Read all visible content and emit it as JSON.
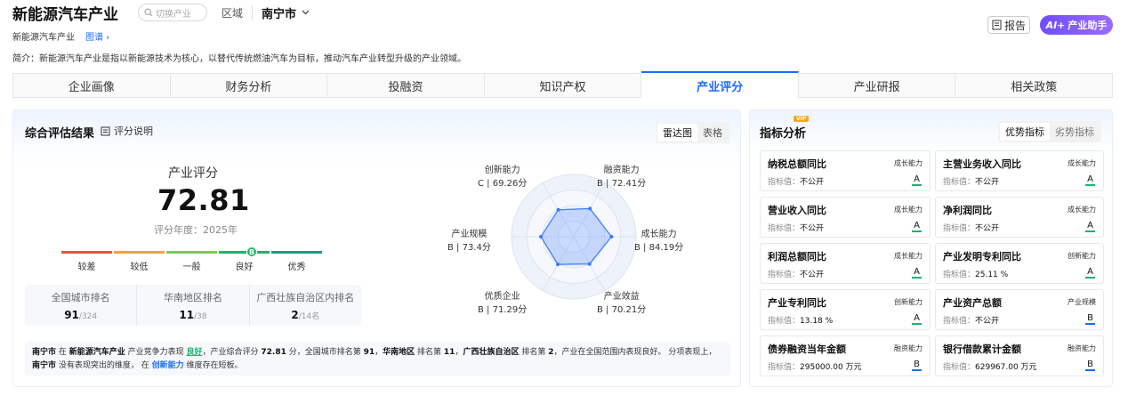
{
  "header": {
    "title": "新能源汽车产业",
    "search_placeholder": "切换产业",
    "region_label": "区域",
    "city": "南宁市"
  },
  "crumbs": {
    "current": "新能源汽车产业",
    "link": "图谱"
  },
  "intro": "简介：新能源汽车产业是指以新能源技术为核心，以替代传统燃油汽车为目标，推动汽车产业转型升级的产业领域。",
  "actions": {
    "report": "报告",
    "ai_badge": "AI+",
    "ai_label": "产业助手"
  },
  "tabs": [
    {
      "label": "企业画像"
    },
    {
      "label": "财务分析"
    },
    {
      "label": "投融资"
    },
    {
      "label": "知识产权"
    },
    {
      "label": "产业评分"
    },
    {
      "label": "产业研报"
    },
    {
      "label": "相关政策"
    }
  ],
  "left_panel": {
    "title": "综合评估结果",
    "explain": "评分说明",
    "view_options": [
      "雷达图",
      "表格"
    ],
    "score_label": "产业评分",
    "score": "72.81",
    "year": "评分年度：2025年",
    "scale": {
      "labels": [
        "较差",
        "较低",
        "一般",
        "良好",
        "优秀"
      ],
      "colors": [
        "#e8562a",
        "#f4a52b",
        "#85c94f",
        "#1db46a",
        "#13a08c"
      ],
      "current_grade": "B",
      "current_level": 4
    },
    "ranks": [
      {
        "label": "全国城市排名",
        "value": "91",
        "total": "/324"
      },
      {
        "label": "华南地区排名",
        "value": "11",
        "total": "/38"
      },
      {
        "label": "广西壮族自治区内排名",
        "value": "2",
        "total": "/14名"
      }
    ],
    "radar": [
      {
        "name": "创新能力",
        "grade": "C | 69.26分"
      },
      {
        "name": "融资能力",
        "grade": "B | 72.41分"
      },
      {
        "name": "成长能力",
        "grade": "B | 84.19分"
      },
      {
        "name": "产业效益",
        "grade": "B | 70.21分"
      },
      {
        "name": "优质企业",
        "grade": "B | 71.29分"
      },
      {
        "name": "产业规模",
        "grade": "B | 73.4分"
      }
    ],
    "radar_scores": [
      69.26,
      72.41,
      84.19,
      70.21,
      71.29,
      73.4
    ],
    "summary": {
      "s1": "南宁市",
      "s2": " 在 ",
      "s3": "新能源汽车产业",
      "s4": " 产业竞争力表现 ",
      "s5": "良好",
      "s6": "，产业综合评分 ",
      "s7": "72.81",
      "s8": " 分，全国城市排名第 ",
      "s9": "91",
      "s10": "，",
      "s11": "华南地区",
      "s12": " 排名第 ",
      "s13": "11",
      "s14": "，",
      "s15": "广西壮族自治区",
      "s16": " 排名第 ",
      "s17": "2",
      "s18": "，产业在全国范围内表现良好。 分项表现上，",
      "s19": "南宁市",
      "s20": " 没有表现突出的维度， 在 ",
      "s21": "创新能力",
      "s22": " 维度存在短板。"
    }
  },
  "right_panel": {
    "title": "指标分析",
    "vip": "VIP",
    "toggle": [
      "优势指标",
      "劣势指标"
    ],
    "value_prefix": "指标值：",
    "cards": [
      {
        "name": "纳税总额同比",
        "tag": "成长能力",
        "value": "不公开",
        "grade": "A"
      },
      {
        "name": "主营业务收入同比",
        "tag": "成长能力",
        "value": "不公开",
        "grade": "A"
      },
      {
        "name": "营业收入同比",
        "tag": "成长能力",
        "value": "不公开",
        "grade": "A"
      },
      {
        "name": "净利润同比",
        "tag": "成长能力",
        "value": "不公开",
        "grade": "A"
      },
      {
        "name": "利润总额同比",
        "tag": "成长能力",
        "value": "不公开",
        "grade": "A"
      },
      {
        "name": "产业发明专利同比",
        "tag": "创新能力",
        "value": "25.11 %",
        "grade": "A"
      },
      {
        "name": "产业专利同比",
        "tag": "创新能力",
        "value": "13.18 %",
        "grade": "A"
      },
      {
        "name": "产业资产总额",
        "tag": "产业规模",
        "value": "不公开",
        "grade": "B"
      },
      {
        "name": "债券融资当年金额",
        "tag": "融资能力",
        "value": "295000.00 万元",
        "grade": "B"
      },
      {
        "name": "银行借款累计金额",
        "tag": "融资能力",
        "value": "629967.00 万元",
        "grade": "B"
      }
    ]
  }
}
